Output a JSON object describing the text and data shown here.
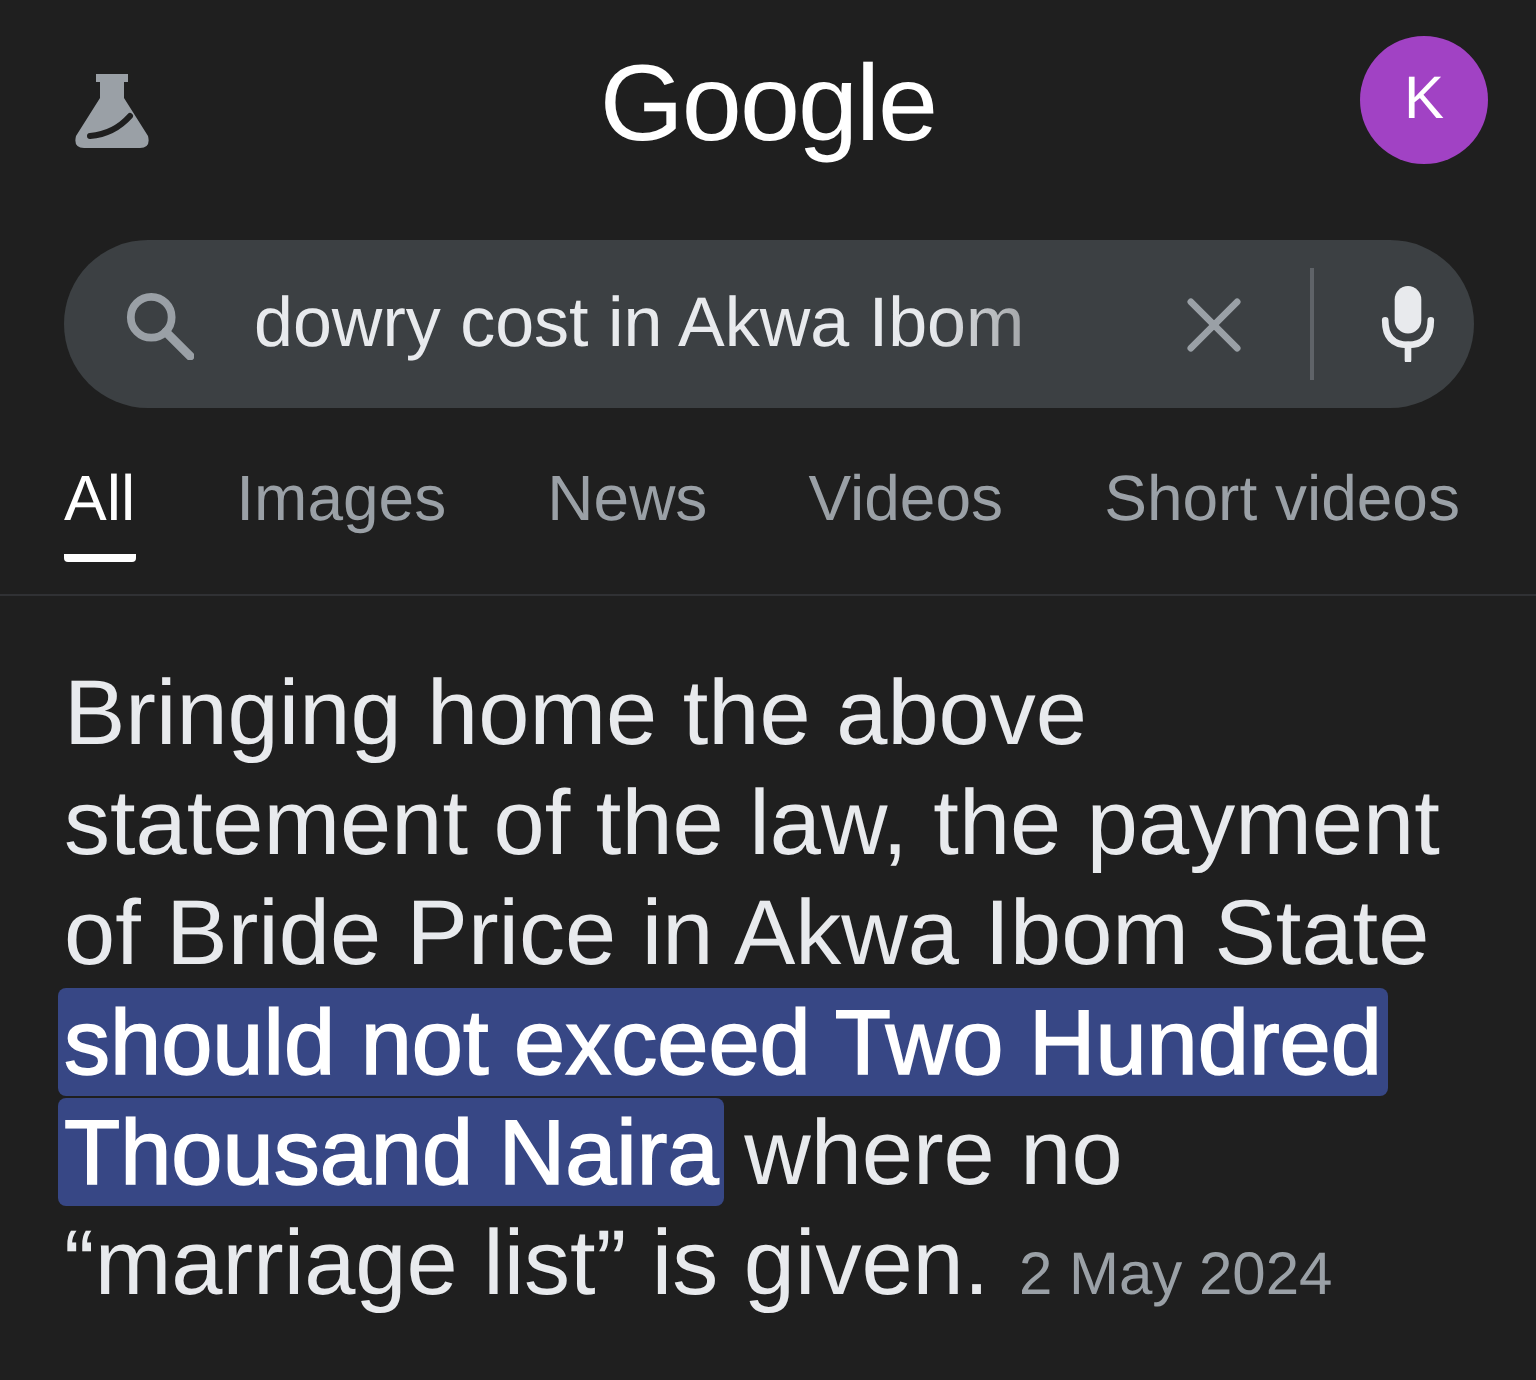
{
  "header": {
    "logo": "Google",
    "avatar": {
      "initial": "K"
    }
  },
  "search": {
    "value": "dowry cost in Akwa Ibom"
  },
  "tabs": [
    {
      "label": "All",
      "selected": true
    },
    {
      "label": "Images",
      "selected": false
    },
    {
      "label": "News",
      "selected": false
    },
    {
      "label": "Videos",
      "selected": false
    },
    {
      "label": "Short videos",
      "selected": false
    }
  ],
  "result": {
    "snippet": "Bringing home the above statement of the law, the payment of Bride Price in Akwa Ibom State **should not exceed Two Hundred Thousand Naira** where no “marriage list” is given.",
    "date": "2 May 2024"
  }
}
